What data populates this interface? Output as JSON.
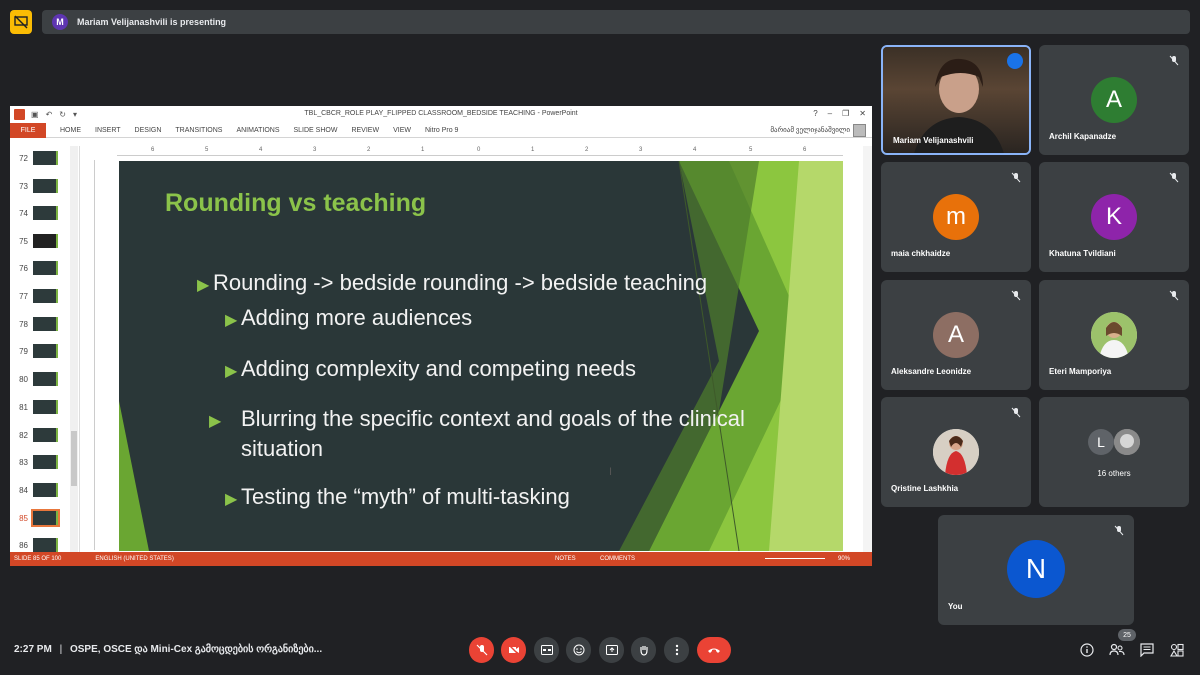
{
  "presenting": {
    "initial": "M",
    "text": "Mariam Velijanashvili is presenting"
  },
  "ppt": {
    "window_title": "TBL_CBCR_ROLE PLAY_FLIPPED CLASSROOM_BEDSIDE TEACHING - PowerPoint",
    "file_tab": "FILE",
    "tabs": [
      "HOME",
      "INSERT",
      "DESIGN",
      "TRANSITIONS",
      "ANIMATIONS",
      "SLIDE SHOW",
      "REVIEW",
      "VIEW",
      "Nitro Pro 9"
    ],
    "user": "მარიამ ველიჯანაშვილი",
    "thumb_numbers": [
      "72",
      "73",
      "74",
      "75",
      "76",
      "77",
      "78",
      "79",
      "80",
      "81",
      "82",
      "83",
      "84",
      "85",
      "86"
    ],
    "selected_slide": "85",
    "ruler_labels": [
      "6",
      "5",
      "4",
      "3",
      "2",
      "1",
      "0",
      "1",
      "2",
      "3",
      "4",
      "5",
      "6"
    ],
    "slide": {
      "title": "Rounding vs teaching",
      "bullets": [
        {
          "level": 1,
          "text": "Rounding -> bedside rounding -> bedside teaching"
        },
        {
          "level": 2,
          "text": "Adding more audiences"
        },
        {
          "level": 2,
          "text": "Adding complexity and competing needs"
        },
        {
          "level": 2,
          "text": "Blurring the specific context and goals of the clinical situation"
        },
        {
          "level": 2,
          "text": "Testing the “myth” of multi-tasking"
        }
      ]
    },
    "status": {
      "slide_of": "SLIDE 85 OF 100",
      "language": "ENGLISH (UNITED STATES)",
      "notes": "NOTES",
      "comments": "COMMENTS",
      "zoom": "90%"
    }
  },
  "participants": [
    {
      "name": "Mariam Velijanashvili",
      "type": "camera"
    },
    {
      "name": "Archil Kapanadze",
      "initial": "A",
      "color": "#2e7d32"
    },
    {
      "name": "maia chkhaidze",
      "initial": "m",
      "color": "#e8710a"
    },
    {
      "name": "Khatuna Tvildiani",
      "initial": "K",
      "color": "#8e24aa"
    },
    {
      "name": "Aleksandre Leonidze",
      "initial": "A",
      "color": "#8d6e63"
    },
    {
      "name": "Eteri Mamporiya",
      "type": "photo"
    },
    {
      "name": "Qristine Lashkhia",
      "type": "photo"
    },
    {
      "name": "16 others",
      "initial": "L",
      "color": "#5f6368"
    },
    {
      "name": "You",
      "initial": "N",
      "color": "#0b57d0"
    }
  ],
  "bottom": {
    "time": "2:27 PM",
    "separator": "|",
    "meeting": "OSPE, OSCE და Mini-Cex გამოცდების ორგანიზები...",
    "participants_count": "25"
  }
}
